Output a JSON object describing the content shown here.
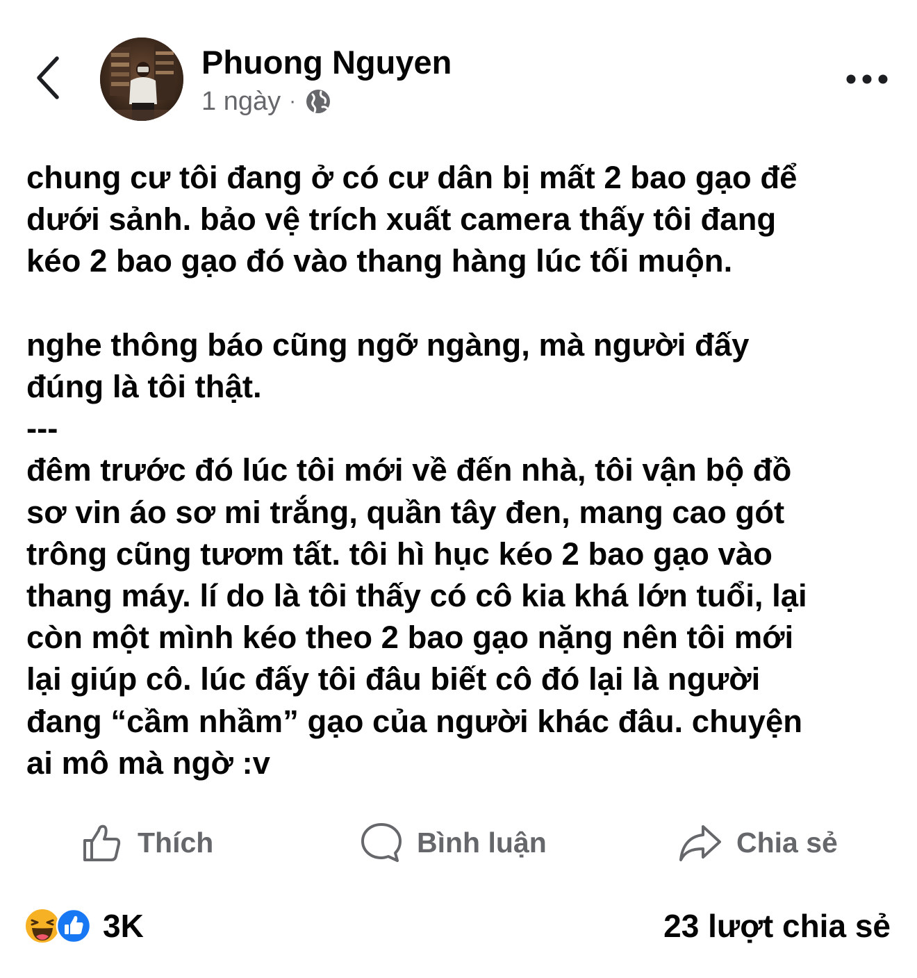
{
  "post": {
    "author_name": "Phuong Nguyen",
    "timestamp": "1 ngày",
    "separator": "·",
    "privacy_icon": "globe-icon",
    "body": "chung cư tôi đang ở có cư dân bị mất 2 bao gạo để\ndưới sảnh. bảo vệ trích xuất camera thấy tôi đang\nkéo 2 bao gạo đó vào thang hàng lúc tối muộn.\n\nnghe thông báo cũng ngỡ ngàng, mà người đấy\nđúng là tôi thật.\n---\nđêm trước đó lúc tôi mới về đến nhà, tôi vận bộ đồ\nsơ vin áo sơ mi trắng, quần tây đen, mang cao gót\ntrông cũng tươm tất. tôi hì hục kéo 2 bao gạo vào\nthang máy. lí do là tôi thấy có cô kia khá lớn tuổi, lại\ncòn một mình kéo theo 2 bao gạo nặng nên tôi mới\nlại giúp cô. lúc đấy tôi đâu biết cô đó lại là người\nđang “cầm nhầm” gạo của người khác đâu. chuyện\nai mô mà ngờ :v"
  },
  "actions": {
    "like_label": "Thích",
    "comment_label": "Bình luận",
    "share_label": "Chia sẻ"
  },
  "stats": {
    "reaction_icons": [
      "haha-icon",
      "like-icon"
    ],
    "reaction_count": "3K",
    "share_count": "23 lượt chia sẻ"
  },
  "colors": {
    "text": "#050505",
    "secondary_text": "#65676b",
    "like_blue": "#1877f2",
    "haha_yellow": "#f7b125"
  }
}
